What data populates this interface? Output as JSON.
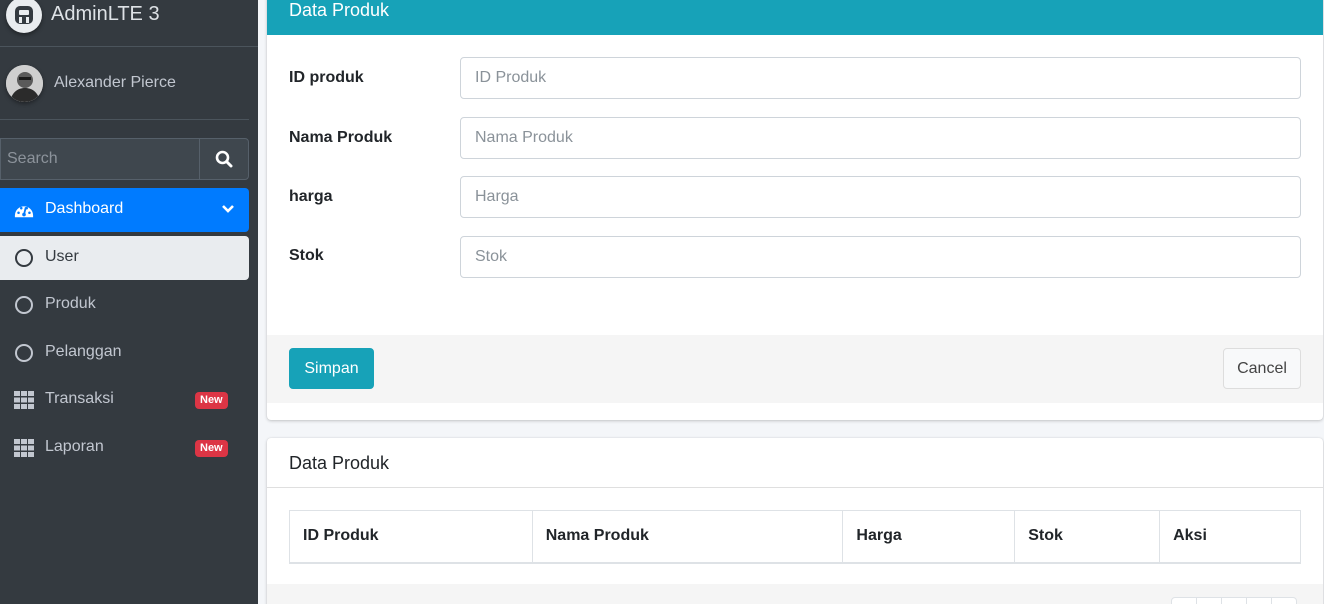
{
  "brand": {
    "name": "AdminLTE 3"
  },
  "user": {
    "name": "Alexander Pierce"
  },
  "search": {
    "placeholder": "Search"
  },
  "nav": {
    "dashboard": "Dashboard",
    "user": "User",
    "produk": "Produk",
    "pelanggan": "Pelanggan",
    "transaksi": "Transaksi",
    "laporan": "Laporan",
    "badge_new": "New"
  },
  "form": {
    "title": "Data Produk",
    "fields": [
      {
        "label": "ID produk",
        "placeholder": "ID Produk"
      },
      {
        "label": "Nama Produk",
        "placeholder": "Nama Produk"
      },
      {
        "label": "harga",
        "placeholder": "Harga"
      },
      {
        "label": "Stok",
        "placeholder": "Stok"
      }
    ],
    "save_label": "Simpan",
    "cancel_label": "Cancel"
  },
  "table": {
    "title": "Data Produk",
    "columns": [
      "ID Produk",
      "Nama Produk",
      "Harga",
      "Stok",
      "Aksi"
    ]
  },
  "colors": {
    "sidebar_bg": "#343a40",
    "primary": "#007bff",
    "info": "#17a2b8",
    "danger": "#dc3545"
  }
}
